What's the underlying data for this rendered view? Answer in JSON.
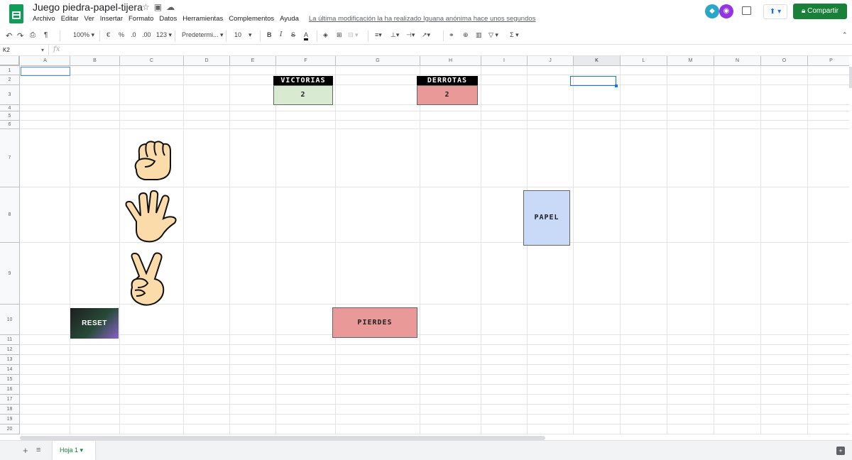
{
  "app": {
    "title": "Juego piedra-papel-tijera",
    "last_edit": "La última modificación la ha realizado Iguana anónima hace unos segundos"
  },
  "menu": [
    "Archivo",
    "Editar",
    "Ver",
    "Insertar",
    "Formato",
    "Datos",
    "Herramientas",
    "Complementos",
    "Ayuda"
  ],
  "share_label": "Compartir",
  "toolbar": {
    "zoom": "100%",
    "currency": "€",
    "percent": "%",
    "dec_less": ".0",
    "dec_more": ".00",
    "format_more": "123",
    "font": "Predetermi...",
    "font_size": "10",
    "bold": "B",
    "italic": "I",
    "strike": "S",
    "text_color": "A"
  },
  "formula_bar": {
    "cell_ref": "K2",
    "fx": "fx",
    "value": ""
  },
  "columns": [
    "A",
    "B",
    "C",
    "D",
    "E",
    "F",
    "G",
    "H",
    "I",
    "J",
    "K",
    "L",
    "M",
    "N",
    "O",
    "P"
  ],
  "rows": [
    "1",
    "2",
    "3",
    "4",
    "5",
    "6",
    "7",
    "8",
    "9",
    "10",
    "11",
    "12",
    "13",
    "14",
    "15",
    "16",
    "17",
    "18",
    "19",
    "20"
  ],
  "selected_cell": "K2",
  "cells": {
    "victorias_label": "VICTORIAS",
    "victorias_value": "2",
    "derrotas_label": "DERROTAS",
    "derrotas_value": "2",
    "choice": "PAPEL",
    "result": "PIERDES",
    "reset": "RESET"
  },
  "hands": [
    "rock-hand",
    "paper-hand",
    "scissors-hand"
  ],
  "colors": {
    "victorias_bg": "#d9ead3",
    "derrotas_bg": "#ea9999",
    "choice_bg": "#c9daf8",
    "result_bg": "#ea9999",
    "share_bg": "#188038",
    "selection": "#1a73e8",
    "hand_fill": "#fbdba9"
  },
  "sheet_tab": "Hoja 1"
}
